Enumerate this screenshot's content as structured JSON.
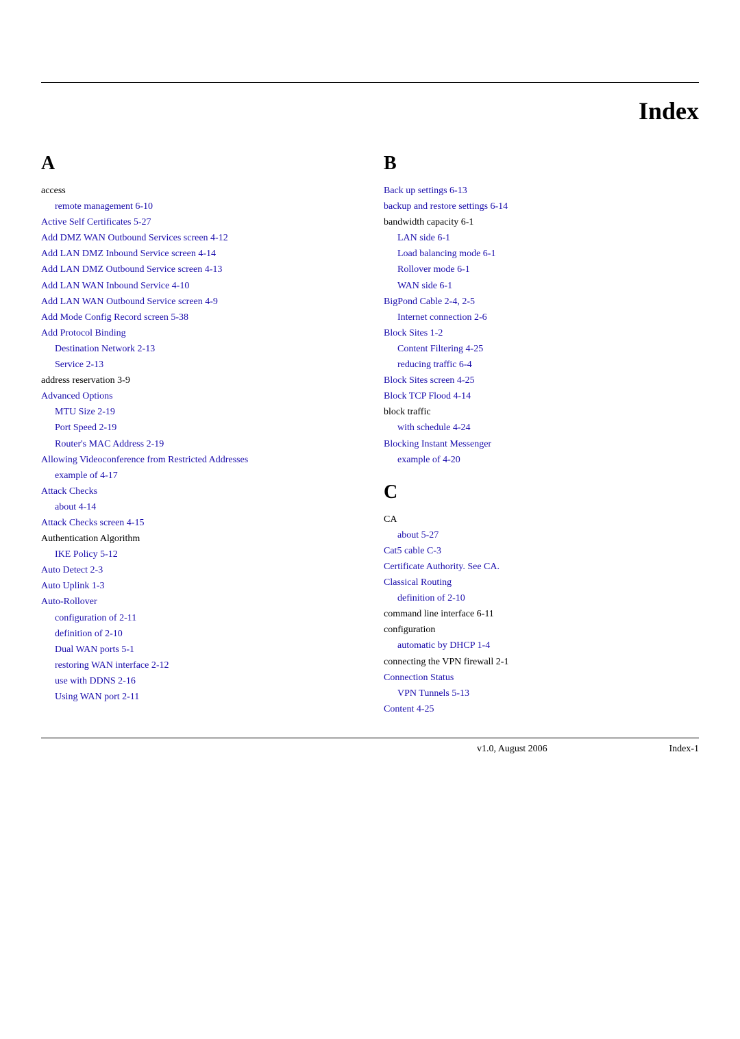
{
  "page": {
    "title": "Index",
    "version": "v1.0, August 2006",
    "page_number": "Index-1"
  },
  "column_a": {
    "letter": "A",
    "entries": [
      {
        "text": "access",
        "page": "",
        "indent": 0,
        "black": true
      },
      {
        "text": "remote management  6-10",
        "page": "6-10",
        "indent": 1
      },
      {
        "text": "Active Self Certificates  5-27",
        "page": "5-27",
        "indent": 0
      },
      {
        "text": "Add DMZ WAN Outbound Services screen  4-12",
        "page": "4-12",
        "indent": 0
      },
      {
        "text": "Add LAN DMZ Inbound Service screen  4-14",
        "page": "4-14",
        "indent": 0
      },
      {
        "text": "Add LAN DMZ Outbound Service screen  4-13",
        "page": "4-13",
        "indent": 0
      },
      {
        "text": "Add LAN WAN Inbound Service  4-10",
        "page": "4-10",
        "indent": 0
      },
      {
        "text": "Add LAN WAN Outbound Service screen  4-9",
        "page": "4-9",
        "indent": 0
      },
      {
        "text": "Add Mode Config Record screen  5-38",
        "page": "5-38",
        "indent": 0
      },
      {
        "text": "Add Protocol Binding",
        "page": "",
        "indent": 0
      },
      {
        "text": "Destination Network  2-13",
        "page": "2-13",
        "indent": 1
      },
      {
        "text": "Service  2-13",
        "page": "2-13",
        "indent": 1
      },
      {
        "text": "address reservation  3-9",
        "page": "3-9",
        "indent": 0,
        "black": true
      },
      {
        "text": "Advanced Options",
        "page": "",
        "indent": 0
      },
      {
        "text": "MTU Size  2-19",
        "page": "2-19",
        "indent": 1
      },
      {
        "text": "Port Speed  2-19",
        "page": "2-19",
        "indent": 1
      },
      {
        "text": "Router's MAC Address  2-19",
        "page": "2-19",
        "indent": 1
      },
      {
        "text": "Allowing Videoconference from Restricted Addresses",
        "page": "",
        "indent": 0
      },
      {
        "text": "example of  4-17",
        "page": "4-17",
        "indent": 1
      },
      {
        "text": "Attack Checks",
        "page": "",
        "indent": 0
      },
      {
        "text": "about  4-14",
        "page": "4-14",
        "indent": 1
      },
      {
        "text": "Attack Checks screen  4-15",
        "page": "4-15",
        "indent": 0
      },
      {
        "text": "Authentication Algorithm",
        "page": "",
        "indent": 0,
        "black": true
      },
      {
        "text": "IKE Policy  5-12",
        "page": "5-12",
        "indent": 1
      },
      {
        "text": "Auto Detect  2-3",
        "page": "2-3",
        "indent": 0
      },
      {
        "text": "Auto Uplink  1-3",
        "page": "1-3",
        "indent": 0
      },
      {
        "text": "Auto-Rollover",
        "page": "",
        "indent": 0
      },
      {
        "text": "configuration of  2-11",
        "page": "2-11",
        "indent": 1
      },
      {
        "text": "definition of  2-10",
        "page": "2-10",
        "indent": 1
      },
      {
        "text": "Dual WAN ports  5-1",
        "page": "5-1",
        "indent": 1
      },
      {
        "text": "restoring WAN interface  2-12",
        "page": "2-12",
        "indent": 1
      },
      {
        "text": "use with DDNS  2-16",
        "page": "2-16",
        "indent": 1
      },
      {
        "text": "Using WAN port  2-11",
        "page": "2-11",
        "indent": 1
      }
    ]
  },
  "column_b": {
    "letter": "B",
    "entries": [
      {
        "text": "Back up settings  6-13",
        "page": "6-13",
        "indent": 0
      },
      {
        "text": "backup and restore settings  6-14",
        "page": "6-14",
        "indent": 0
      },
      {
        "text": "bandwidth capacity  6-1",
        "page": "6-1",
        "indent": 0,
        "black": true
      },
      {
        "text": "LAN side  6-1",
        "page": "6-1",
        "indent": 1
      },
      {
        "text": "Load balancing mode  6-1",
        "page": "6-1",
        "indent": 1
      },
      {
        "text": "Rollover mode  6-1",
        "page": "6-1",
        "indent": 1
      },
      {
        "text": "WAN side  6-1",
        "page": "6-1",
        "indent": 1
      },
      {
        "text": "BigPond Cable  2-4, 2-5",
        "page": "2-4, 2-5",
        "indent": 0
      },
      {
        "text": "Internet connection  2-6",
        "page": "2-6",
        "indent": 1
      },
      {
        "text": "Block Sites  1-2",
        "page": "1-2",
        "indent": 0
      },
      {
        "text": "Content Filtering  4-25",
        "page": "4-25",
        "indent": 1
      },
      {
        "text": "reducing traffic  6-4",
        "page": "6-4",
        "indent": 1
      },
      {
        "text": "Block Sites screen  4-25",
        "page": "4-25",
        "indent": 0
      },
      {
        "text": "Block TCP Flood  4-14",
        "page": "4-14",
        "indent": 0
      },
      {
        "text": "block traffic",
        "page": "",
        "indent": 0,
        "black": true
      },
      {
        "text": "with schedule  4-24",
        "page": "4-24",
        "indent": 1
      },
      {
        "text": "Blocking Instant Messenger",
        "page": "",
        "indent": 0
      },
      {
        "text": "example of  4-20",
        "page": "4-20",
        "indent": 1
      }
    ]
  },
  "column_c": {
    "letter": "C",
    "entries": [
      {
        "text": "CA",
        "page": "",
        "indent": 0,
        "black": true
      },
      {
        "text": "about  5-27",
        "page": "5-27",
        "indent": 1
      },
      {
        "text": "Cat5 cable  C-3",
        "page": "C-3",
        "indent": 0
      },
      {
        "text": "Certificate Authority. See CA.",
        "page": "",
        "indent": 0
      },
      {
        "text": "Classical Routing",
        "page": "",
        "indent": 0
      },
      {
        "text": "definition of  2-10",
        "page": "2-10",
        "indent": 1
      },
      {
        "text": "command line interface  6-11",
        "page": "6-11",
        "indent": 0,
        "black": true
      },
      {
        "text": "configuration",
        "page": "",
        "indent": 0,
        "black": true
      },
      {
        "text": "automatic by DHCP  1-4",
        "page": "1-4",
        "indent": 1
      },
      {
        "text": "connecting the VPN firewall  2-1",
        "page": "2-1",
        "indent": 0,
        "black": true
      },
      {
        "text": "Connection Status",
        "page": "",
        "indent": 0
      },
      {
        "text": "VPN Tunnels  5-13",
        "page": "5-13",
        "indent": 1
      },
      {
        "text": "Content  4-25",
        "page": "4-25",
        "indent": 0
      }
    ]
  }
}
